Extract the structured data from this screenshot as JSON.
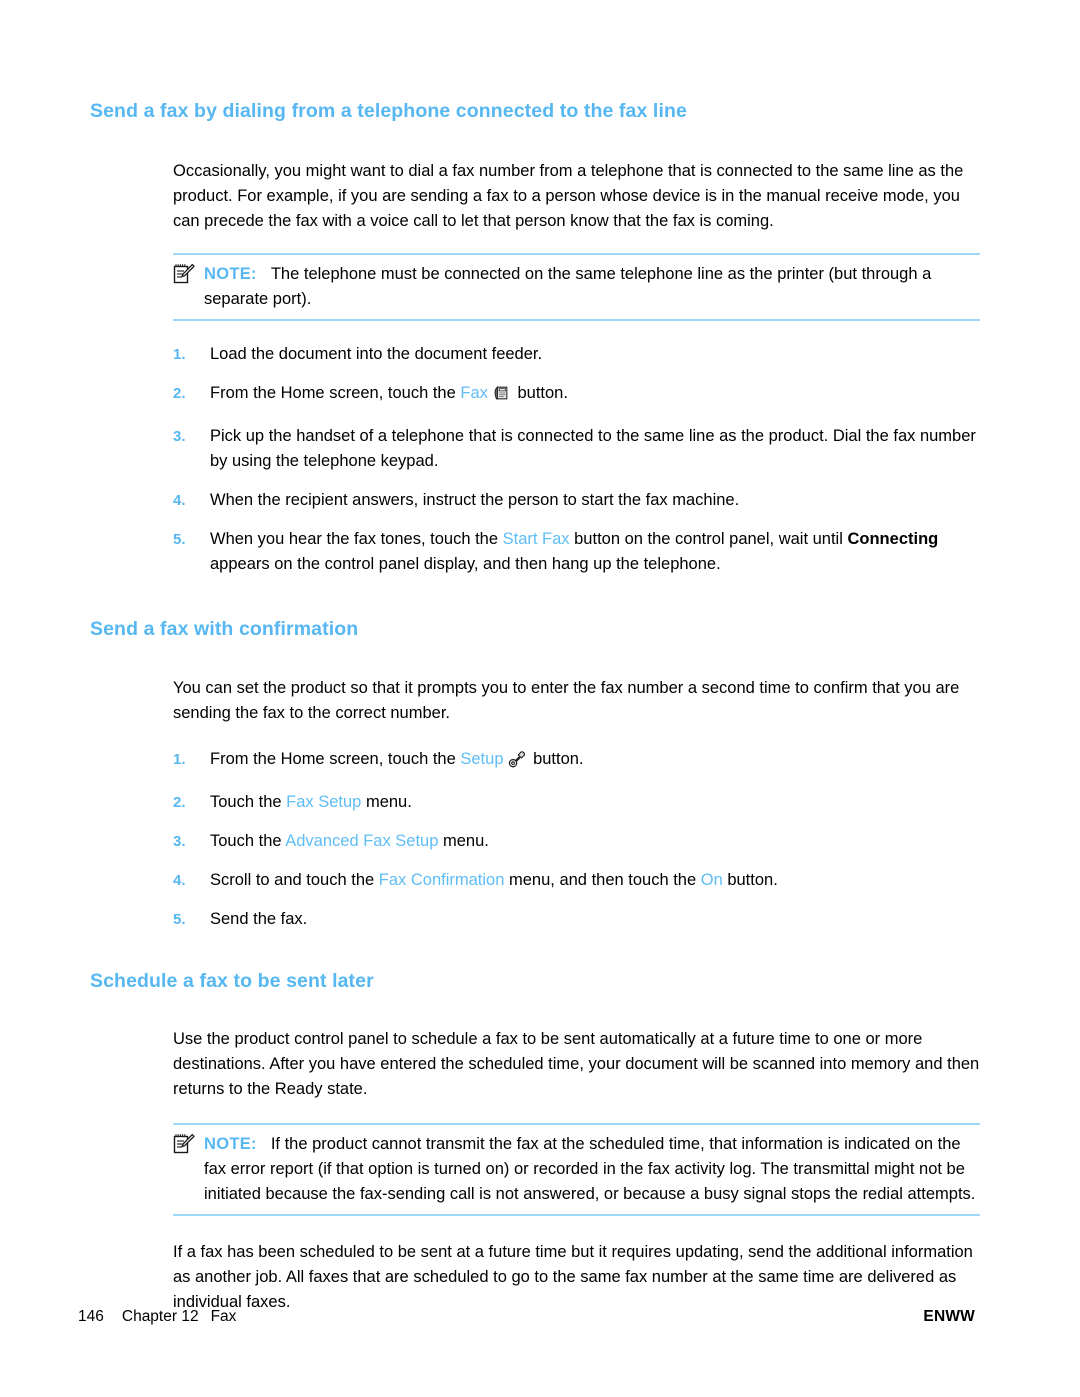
{
  "page": {
    "number": "146",
    "chapter": "Chapter 12",
    "chapter_topic": "Fax",
    "footer_right": "ENWW",
    "accent_color": "#56b7f2",
    "rule_color": "#9ed7f7"
  },
  "sections": [
    {
      "heading": "Send a fax by dialing from a telephone connected to the fax line",
      "intro": "Occasionally, you might want to dial a fax number from a telephone that is connected to the same line as the product. For example, if you are sending a fax to a person whose device is in the manual receive mode, you can precede the fax with a voice call to let that person know that the fax is coming.",
      "note": {
        "label": "NOTE:",
        "icon": "note-pencil-icon",
        "text": "The telephone must be connected on the same telephone line as the printer (but through a separate port)."
      },
      "steps": [
        {
          "num": "1.",
          "pre": "Load the document into the document feeder.",
          "ui": "",
          "post": ""
        },
        {
          "num": "2.",
          "pre": "From the Home screen, touch the ",
          "ui": "Fax",
          "icon": "fax-machine-icon",
          "post": " button."
        },
        {
          "num": "3.",
          "pre": "Pick up the handset of a telephone that is connected to the same line as the product. Dial the fax number by using the telephone keypad.",
          "ui": "",
          "post": ""
        },
        {
          "num": "4.",
          "pre": "When the recipient answers, instruct the person to start the fax machine.",
          "ui": "",
          "post": ""
        },
        {
          "num": "5.",
          "pre": "When you hear the fax tones, touch the ",
          "ui": "Start Fax",
          "post": " button on the control panel, wait until ",
          "bold": "Connecting",
          "post2": " appears on the control panel display, and then hang up the telephone."
        }
      ]
    },
    {
      "heading": "Send a fax with confirmation",
      "intro": "You can set the product so that it prompts you to enter the fax number a second time to confirm that you are sending the fax to the correct number.",
      "steps": [
        {
          "num": "1.",
          "pre": "From the Home screen, touch the ",
          "ui": "Setup",
          "icon": "wrench-gear-icon",
          "post": " button."
        },
        {
          "num": "2.",
          "pre": "Touch the ",
          "ui": "Fax Setup",
          "post": " menu."
        },
        {
          "num": "3.",
          "pre": "Touch the ",
          "ui": "Advanced Fax Setup",
          "post": " menu."
        },
        {
          "num": "4.",
          "pre": "Scroll to and touch the ",
          "ui": "Fax Confirmation",
          "post": " menu, and then touch the ",
          "ui2": "On",
          "post2": " button."
        },
        {
          "num": "5.",
          "pre": "Send the fax.",
          "ui": "",
          "post": ""
        }
      ]
    },
    {
      "heading": "Schedule a fax to be sent later",
      "intro": "Use the product control panel to schedule a fax to be sent automatically at a future time to one or more destinations. After you have entered the scheduled time, your document will be scanned into memory and then returns to the Ready state.",
      "note": {
        "label": "NOTE:",
        "icon": "note-pencil-icon",
        "text": "If the product cannot transmit the fax at the scheduled time, that information is indicated on the fax error report (if that option is turned on) or recorded in the fax activity log. The transmittal might not be initiated because the fax-sending call is not answered, or because a busy signal stops the redial attempts."
      },
      "outro": "If a fax has been scheduled to be sent at a future time but it requires updating, send the additional information as another job. All faxes that are scheduled to go to the same fax number at the same time are delivered as individual faxes."
    }
  ]
}
